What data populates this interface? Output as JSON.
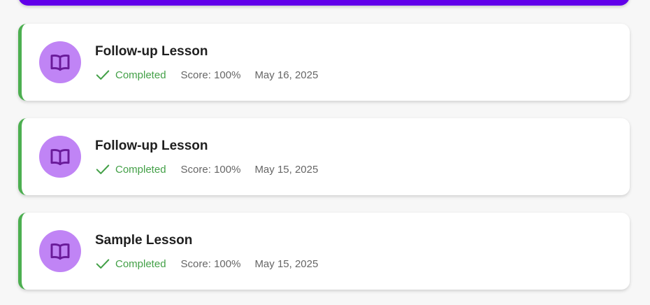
{
  "colors": {
    "accent": "#6200ea",
    "completed": "#43a047",
    "card_border": "#4caf50",
    "avatar_bg": "#c084f5",
    "icon": "#6a1b9a"
  },
  "lessons": [
    {
      "title": "Follow-up Lesson",
      "status": "Completed",
      "score": "Score: 100%",
      "date": "May 16, 2025",
      "icon": "book-icon"
    },
    {
      "title": "Follow-up Lesson",
      "status": "Completed",
      "score": "Score: 100%",
      "date": "May 15, 2025",
      "icon": "book-icon"
    },
    {
      "title": "Sample Lesson",
      "status": "Completed",
      "score": "Score: 100%",
      "date": "May 15, 2025",
      "icon": "book-icon"
    }
  ]
}
